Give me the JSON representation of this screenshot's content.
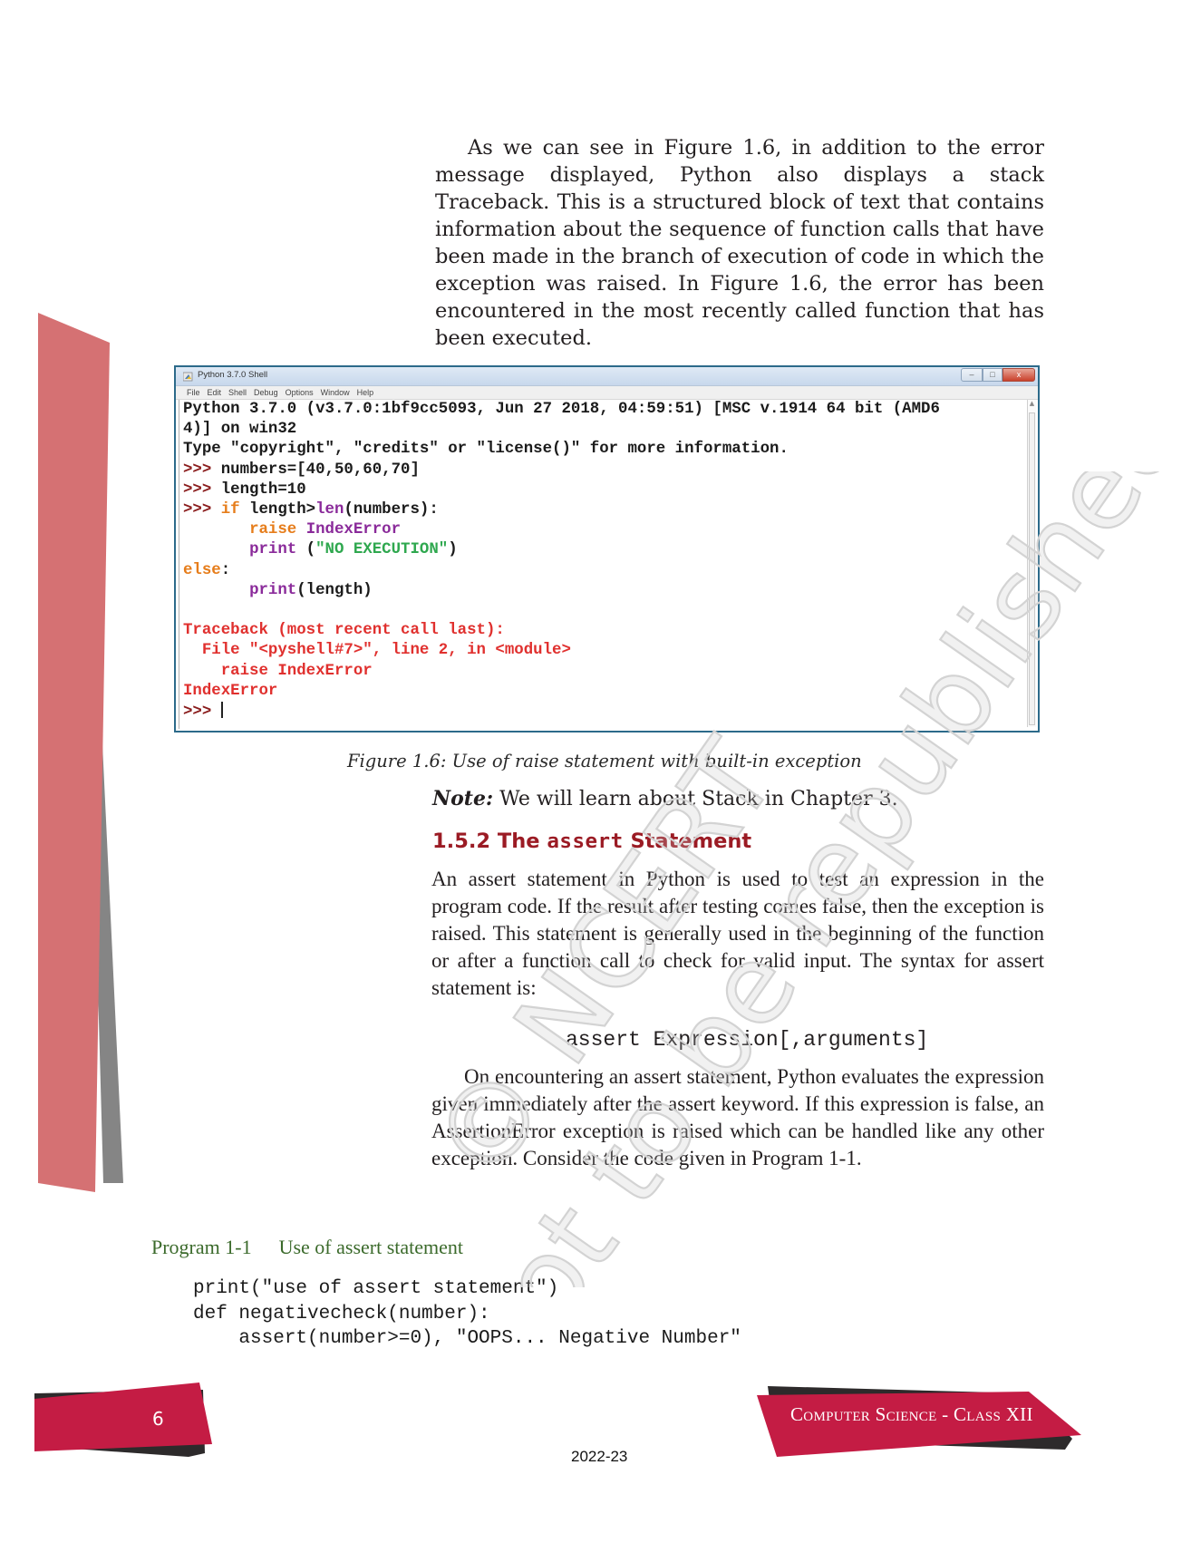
{
  "paragraphs": {
    "intro": "As we can see in Figure 1.6, in addition to the error message displayed, Python also displays a stack Traceback. This is a structured block of text that contains information about the sequence of function calls that have been made in the branch of execution of code in which the exception was raised. In Figure 1.6, the error has been encountered in the most recently called function that has been executed.",
    "assert_intro": "An assert statement in Python is used to test an expression in the program code. If the result after testing comes false, then the exception is raised. This statement is generally used in the beginning of the function or after a function call to check for valid input. The syntax for assert statement is:",
    "assert_syntax": "assert Expression[,arguments]",
    "assert_explain": "On encountering an assert statement, Python evaluates the expression given immediately after the assert keyword. If this expression is false, an AssertionError exception is raised which can be handled like any other exception. Consider the code given in Program 1-1."
  },
  "figure": {
    "window_title": "Python 3.7.0 Shell",
    "window_buttons": {
      "minimize": "–",
      "maximize": "□",
      "close": "x"
    },
    "menu": [
      "File",
      "Edit",
      "Shell",
      "Debug",
      "Options",
      "Window",
      "Help"
    ],
    "shell": {
      "banner_1": "Python 3.7.0 (v3.7.0:1bf9cc5093, Jun 27 2018, 04:59:51) [MSC v.1914 64 bit (AMD6",
      "banner_2": "4)] on win32",
      "banner_3": "Type \"copyright\", \"credits\" or \"license()\" for more information.",
      "prompt": ">>>",
      "line_numbers": " numbers=[40,50,60,70]",
      "line_length": " length=10",
      "if_kw": "if",
      "if_rest_1": " length>",
      "if_len": "len",
      "if_rest_2": "(numbers):",
      "indent": "       ",
      "raise_kw": "raise",
      "raise_exc": "IndexError",
      "print_kw": "print",
      "print_open": " (",
      "print_str": "\"NO EXECUTION\"",
      "print_close": ")",
      "else_kw": "else",
      "else_colon": ":",
      "print2_kw": "print",
      "print2_rest": "(length)",
      "tb_1": "Traceback (most recent call last):",
      "tb_2": "  File \"<pyshell#7>\", line 2, in <module>",
      "tb_3": "    raise IndexError",
      "tb_4": "IndexError",
      "final_prompt": ">>> "
    },
    "caption": "Figure 1.6:  Use of raise statement with built-in exception"
  },
  "note": {
    "label": "Note:",
    "text": " We will learn about Stack in Chapter 3."
  },
  "section": {
    "number": "1.5.2 The ",
    "keyword": "assert",
    "title": " Statement"
  },
  "program": {
    "label": "Program 1-1",
    "title": "Use of assert statement",
    "code": "print(\"use of assert statement\")\ndef negativecheck(number):\n    assert(number>=0), \"OOPS... Negative Number\""
  },
  "watermark": {
    "line1": "© NCERT",
    "line2": "not to be republished"
  },
  "footer": {
    "page_number": "6",
    "book_title": "Computer Science - Class XII",
    "year": "2022-23"
  },
  "colors": {
    "accent_red": "#c41c44",
    "side_pink": "#d57173",
    "side_grey": "#858585",
    "heading_red": "#9b1b24",
    "program_green": "#3b6a2b"
  }
}
